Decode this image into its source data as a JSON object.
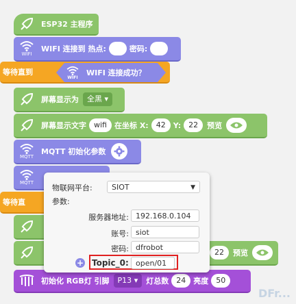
{
  "blocks": {
    "main_label": "ESP32 主程序",
    "wifi_connect_label": "WIFI 连接到 热点:",
    "wifi_password_label": "密码:",
    "wait_until_label": "等待直到",
    "wifi_success_label": "WIFI 连接成功？",
    "screen_display_label": "屏幕显示为",
    "screen_display_value": "全黑",
    "screen_text_label": "屏幕显示文字",
    "screen_text_value": "wifi",
    "at_coords_label": "在坐标 X:",
    "x_value": "42",
    "y_label": "Y:",
    "y_value": "22",
    "preview_label": "预览",
    "preview_label2": "预览",
    "y_value2": "22",
    "mqtt_init_label": "MQTT 初始化参数",
    "wait_partial": "等待直",
    "rgb_label": "初始化 RGB灯 引脚",
    "rgb_pin": "P13",
    "rgb_total_label": "灯总数",
    "rgb_total": "24",
    "rgb_brightness_label": "亮度",
    "rgb_brightness": "50"
  },
  "icons": {
    "wifi_caption": "WIFI",
    "mqtt_caption": "MQTT"
  },
  "panel": {
    "platform_label": "物联网平台:",
    "platform_value": "SIOT",
    "params_label": "参数:",
    "server_label": "服务器地址:",
    "server_value": "192.168.0.104",
    "account_label": "账号:",
    "account_value": "siot",
    "password_label": "密码:",
    "password_value": "dfrobot",
    "topic_label": "Topic_0:",
    "topic_value": "open/01"
  },
  "watermark": "DFr..."
}
